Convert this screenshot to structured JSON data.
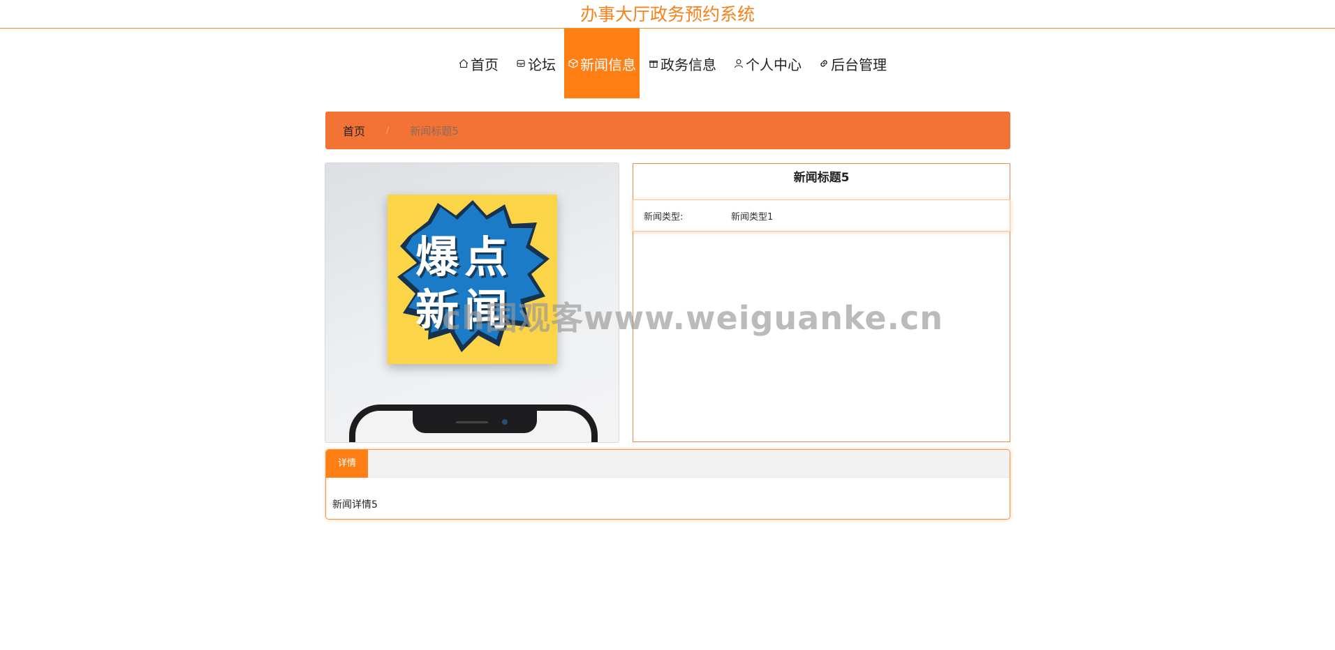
{
  "header": {
    "title": "办事大厅政务预约系统"
  },
  "nav": {
    "items": [
      {
        "label": "首页",
        "icon": "home-icon"
      },
      {
        "label": "论坛",
        "icon": "forum-icon"
      },
      {
        "label": "新闻信息",
        "icon": "box-icon",
        "active": true
      },
      {
        "label": "政务信息",
        "icon": "gift-icon"
      },
      {
        "label": "个人中心",
        "icon": "user-icon"
      },
      {
        "label": "后台管理",
        "icon": "link-icon"
      }
    ]
  },
  "breadcrumb": {
    "home": "首页",
    "separator": "/",
    "current": "新闻标题5"
  },
  "image": {
    "poster_line1": "爆点",
    "poster_line2": "新闻"
  },
  "info": {
    "title": "新闻标题5",
    "rows": [
      {
        "key": "新闻类型:",
        "value": "新闻类型1"
      }
    ]
  },
  "details": {
    "tab": "详情",
    "content": "新闻详情5"
  },
  "watermark": "ch国观客www.weiguanke.cn",
  "colors": {
    "accent": "#ff7f15",
    "breadcrumb_bg": "#f37335",
    "title": "#f7821b"
  }
}
